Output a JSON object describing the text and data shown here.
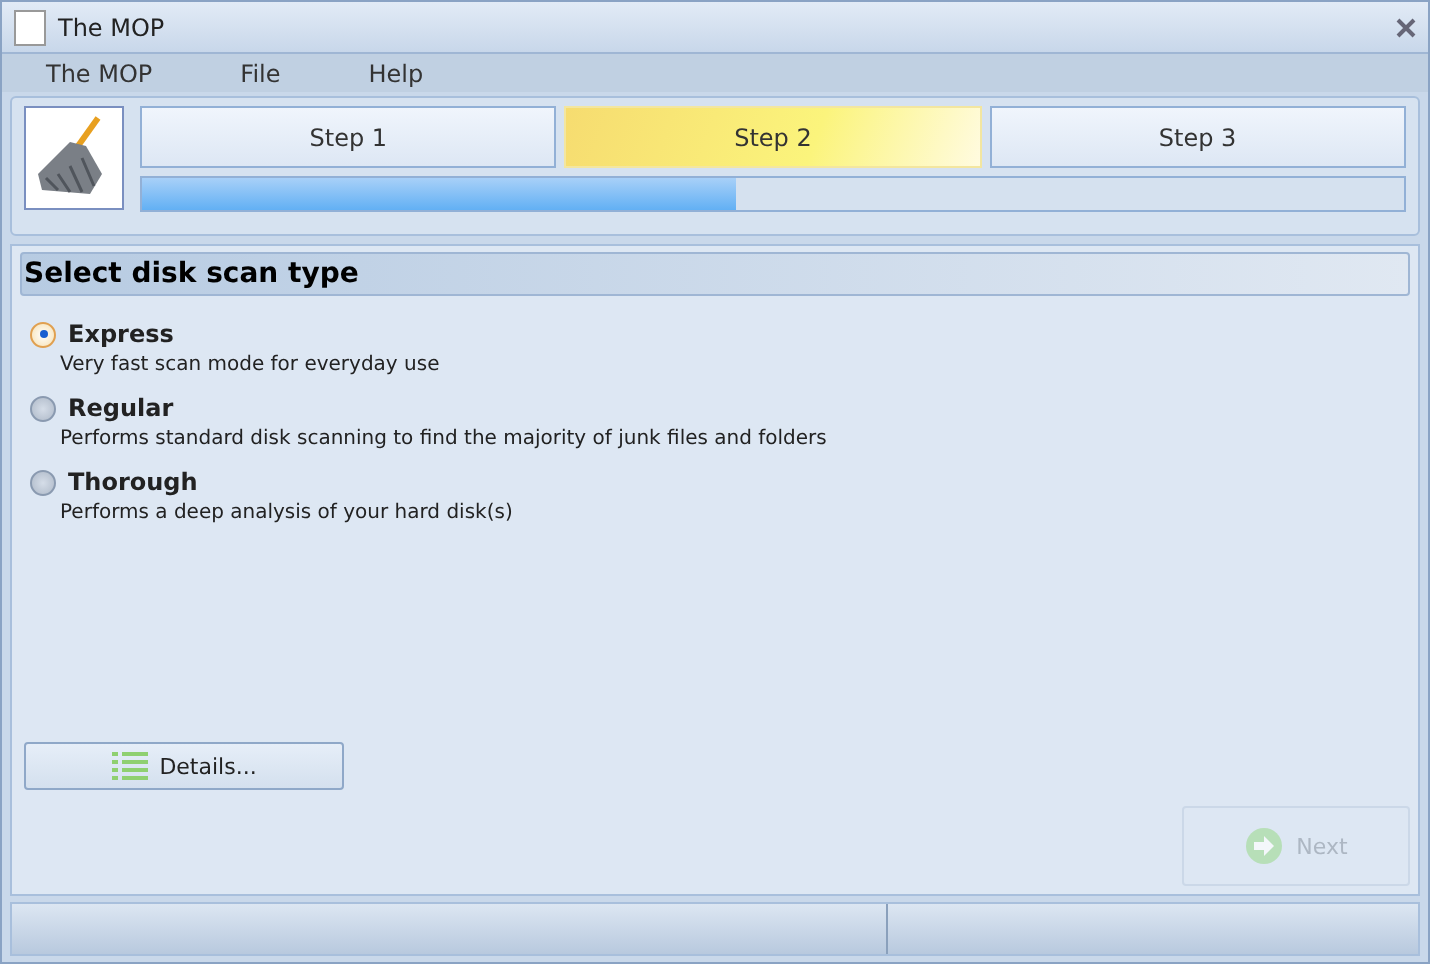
{
  "window": {
    "title": "The MOP"
  },
  "menu": [
    "The MOP",
    "File",
    "Help"
  ],
  "steps": [
    {
      "label": "Step 1",
      "selected": false
    },
    {
      "label": "Step 2",
      "selected": true
    },
    {
      "label": "Step 3",
      "selected": false
    }
  ],
  "progress": {
    "level": 0.47
  },
  "section": {
    "title": "Select disk scan type"
  },
  "options": [
    {
      "label": "Express",
      "description": "Very fast scan mode for everyday use",
      "selected": true
    },
    {
      "label": "Regular",
      "description": "Performs standard disk scanning to find the majority of junk files and folders",
      "selected": false
    },
    {
      "label": "Thorough",
      "description": "Performs a deep analysis of your hard disk(s)",
      "selected": false
    }
  ],
  "details_button": {
    "label": "Details..."
  },
  "next_button": {
    "label": "Next",
    "disabled": true
  }
}
